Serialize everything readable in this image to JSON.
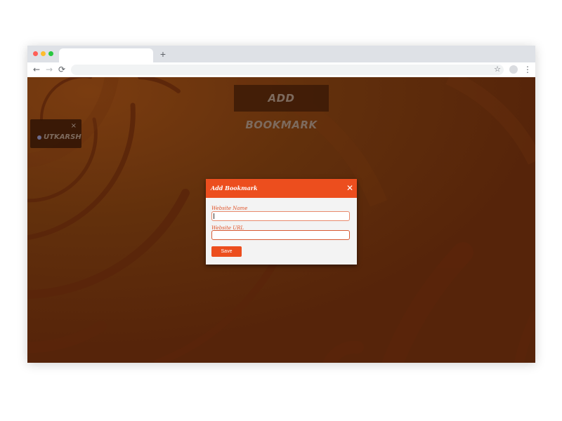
{
  "browser": {
    "tab_title": "",
    "new_tab_label": "+",
    "address": "",
    "icons": {
      "back": "←",
      "forward": "→",
      "reload": "⟳",
      "star": "☆",
      "menu": "⋮"
    },
    "traffic_light_colors": [
      "#ff5f57",
      "#febc2e",
      "#28c840"
    ]
  },
  "page": {
    "background_color": "#5e2b0b",
    "add_bookmark_label": "ADD BOOKMARK",
    "bookmarks": [
      {
        "name": "UTKARSH",
        "close": "×"
      }
    ]
  },
  "modal": {
    "title": "Add Bookmark",
    "close_glyph": "✕",
    "accent_color": "#ec4e1e",
    "fields": {
      "name_label": "Website Name",
      "name_value": "",
      "url_label": "Website URL",
      "url_value": ""
    },
    "save_label": "Save"
  }
}
